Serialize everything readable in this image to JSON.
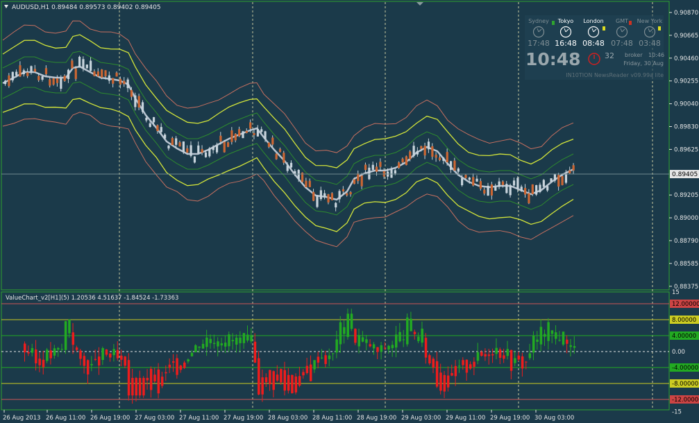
{
  "main_chart": {
    "header": "AUDUSD,H1  0.89484 0.89573 0.89402 0.89405",
    "price_labels": [
      "0.90870",
      "0.90665",
      "0.90460",
      "0.90255",
      "0.90040",
      "0.89830",
      "0.89625",
      "0.89405",
      "0.89205",
      "0.89000",
      "0.88790",
      "0.88585",
      "0.88375"
    ],
    "current_price": "0.89405"
  },
  "news_widget": {
    "cities": [
      {
        "name": "Sydney",
        "time": "17:48"
      },
      {
        "name": "Tokyo",
        "time": "16:48"
      },
      {
        "name": "London",
        "time": "08:48"
      },
      {
        "name": "GMT",
        "time": "07:48"
      },
      {
        "name": "New York",
        "time": "03:48"
      }
    ],
    "big_time": "10:48",
    "seconds": "32",
    "broker_label": "broker",
    "broker_time": "10:46",
    "broker_date": "Friday, 30 Aug",
    "footer": "IN10TION NewsReader v09.99a lite"
  },
  "value_chart": {
    "header": "ValueChart_v2[H1](5) 1.20536 4.51637 -1.84524 -1.73363",
    "axis_labels": [
      "15",
      "12.00000",
      "8.00000",
      "4.00000",
      "0.00",
      "-4.00000",
      "-8.00000",
      "-12.00000",
      "-15"
    ],
    "colors": {
      "up": "#22aa22",
      "down": "#ee1c1c",
      "level_12": "#cc5555",
      "level_8": "#cccc22",
      "level_4": "#22aa22"
    }
  },
  "time_axis": [
    "26 Aug 2013",
    "26 Aug 11:00",
    "26 Aug 19:00",
    "27 Aug 03:00",
    "27 Aug 11:00",
    "27 Aug 19:00",
    "28 Aug 03:00",
    "28 Aug 11:00",
    "28 Aug 19:00",
    "29 Aug 03:00",
    "29 Aug 11:00",
    "29 Aug 19:00",
    "30 Aug 03:00"
  ],
  "colors": {
    "background": "#1b3a4a",
    "frame": "#2fa32f",
    "text": "#e6e6e6",
    "bull": "#c8d4dc",
    "bear": "#cc6633",
    "mid_band": "#b8c4d0",
    "inner_band": "#2e8b2e",
    "middle_band": "#d4e63a",
    "outer_band": "#c87060"
  }
}
